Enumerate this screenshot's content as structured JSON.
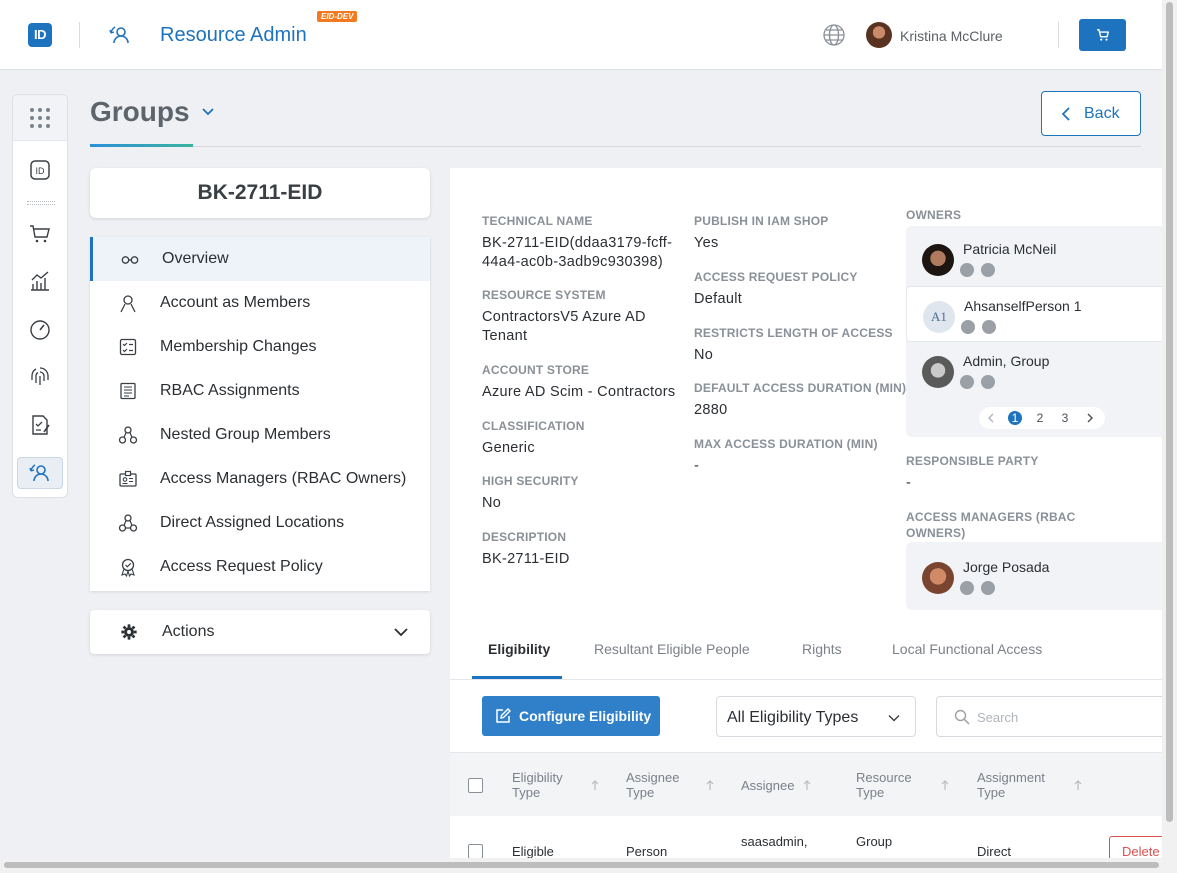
{
  "header": {
    "logo_text": "ID",
    "app_title": "Resource Admin",
    "env_badge": "EID-DEV",
    "user_name": "Kristina McClure"
  },
  "page": {
    "title": "Groups",
    "back_label": "Back"
  },
  "left": {
    "resource_name": "BK-2711-EID",
    "menu": [
      {
        "label": "Overview",
        "icon": "glasses-icon",
        "active": true
      },
      {
        "label": "Account as Members",
        "icon": "person-icon"
      },
      {
        "label": "Membership Changes",
        "icon": "checklist-icon"
      },
      {
        "label": "RBAC Assignments",
        "icon": "document-list-icon"
      },
      {
        "label": "Nested Group Members",
        "icon": "hierarchy-icon"
      },
      {
        "label": "Access Managers (RBAC Owners)",
        "icon": "id-card-icon"
      },
      {
        "label": "Direct Assigned Locations",
        "icon": "network-icon"
      },
      {
        "label": "Access Request Policy",
        "icon": "badge-icon"
      }
    ],
    "actions_label": "Actions"
  },
  "details": {
    "technical_name_label": "TECHNICAL NAME",
    "technical_name_line1": "BK-2711-EID(ddaa3179-fcff-",
    "technical_name_line2": "44a4-ac0b-3adb9c930398)",
    "resource_system_label": "RESOURCE SYSTEM",
    "resource_system_line1": "ContractorsV5 Azure AD",
    "resource_system_line2": "Tenant",
    "account_store_label": "ACCOUNT STORE",
    "account_store": "Azure AD Scim - Contractors",
    "classification_label": "CLASSIFICATION",
    "classification": "Generic",
    "high_security_label": "HIGH SECURITY",
    "high_security": "No",
    "description_label": "DESCRIPTION",
    "description": "BK-2711-EID",
    "publish_label": "PUBLISH IN IAM SHOP",
    "publish": "Yes",
    "arp_label": "ACCESS REQUEST POLICY",
    "arp": "Default",
    "restricts_label": "RESTRICTS LENGTH OF ACCESS",
    "restricts": "No",
    "default_duration_label": "DEFAULT ACCESS DURATION (MIN)",
    "default_duration": "2880",
    "max_duration_label": "MAX ACCESS DURATION (MIN)",
    "max_duration": "-",
    "owners_label": "OWNERS",
    "owners": [
      {
        "name": "Patricia McNeil"
      },
      {
        "name": "AhsanselfPerson 1",
        "initials": "A1"
      },
      {
        "name": "Admin, Group"
      }
    ],
    "pager": {
      "pages": [
        "1",
        "2",
        "3"
      ],
      "current": "1"
    },
    "responsible_label": "RESPONSIBLE PARTY",
    "responsible": "-",
    "access_managers_label_line1": "ACCESS MANAGERS (RBAC",
    "access_managers_label_line2": "OWNERS)",
    "access_manager_name": "Jorge Posada"
  },
  "tabs": [
    "Eligibility",
    "Resultant Eligible People",
    "Rights",
    "Local Functional Access"
  ],
  "toolbar": {
    "configure_label": "Configure Eligibility",
    "filter_value": "All Eligibility Types",
    "search_placeholder": "Search"
  },
  "table": {
    "headers": [
      {
        "line1": "Eligibility",
        "line2": "Type"
      },
      {
        "line1": "Assignee",
        "line2": "Type"
      },
      {
        "line1": "Assignee",
        "line2": ""
      },
      {
        "line1": "Resource",
        "line2": "Type"
      },
      {
        "line1": "Assignment",
        "line2": "Type"
      }
    ],
    "rows": [
      {
        "eligibility_type": "Eligible",
        "assignee_type": "Person",
        "assignee": "saasadmin,",
        "resource_type": "Group",
        "assignment_type": "Direct",
        "delete_label": "Delete"
      }
    ]
  }
}
